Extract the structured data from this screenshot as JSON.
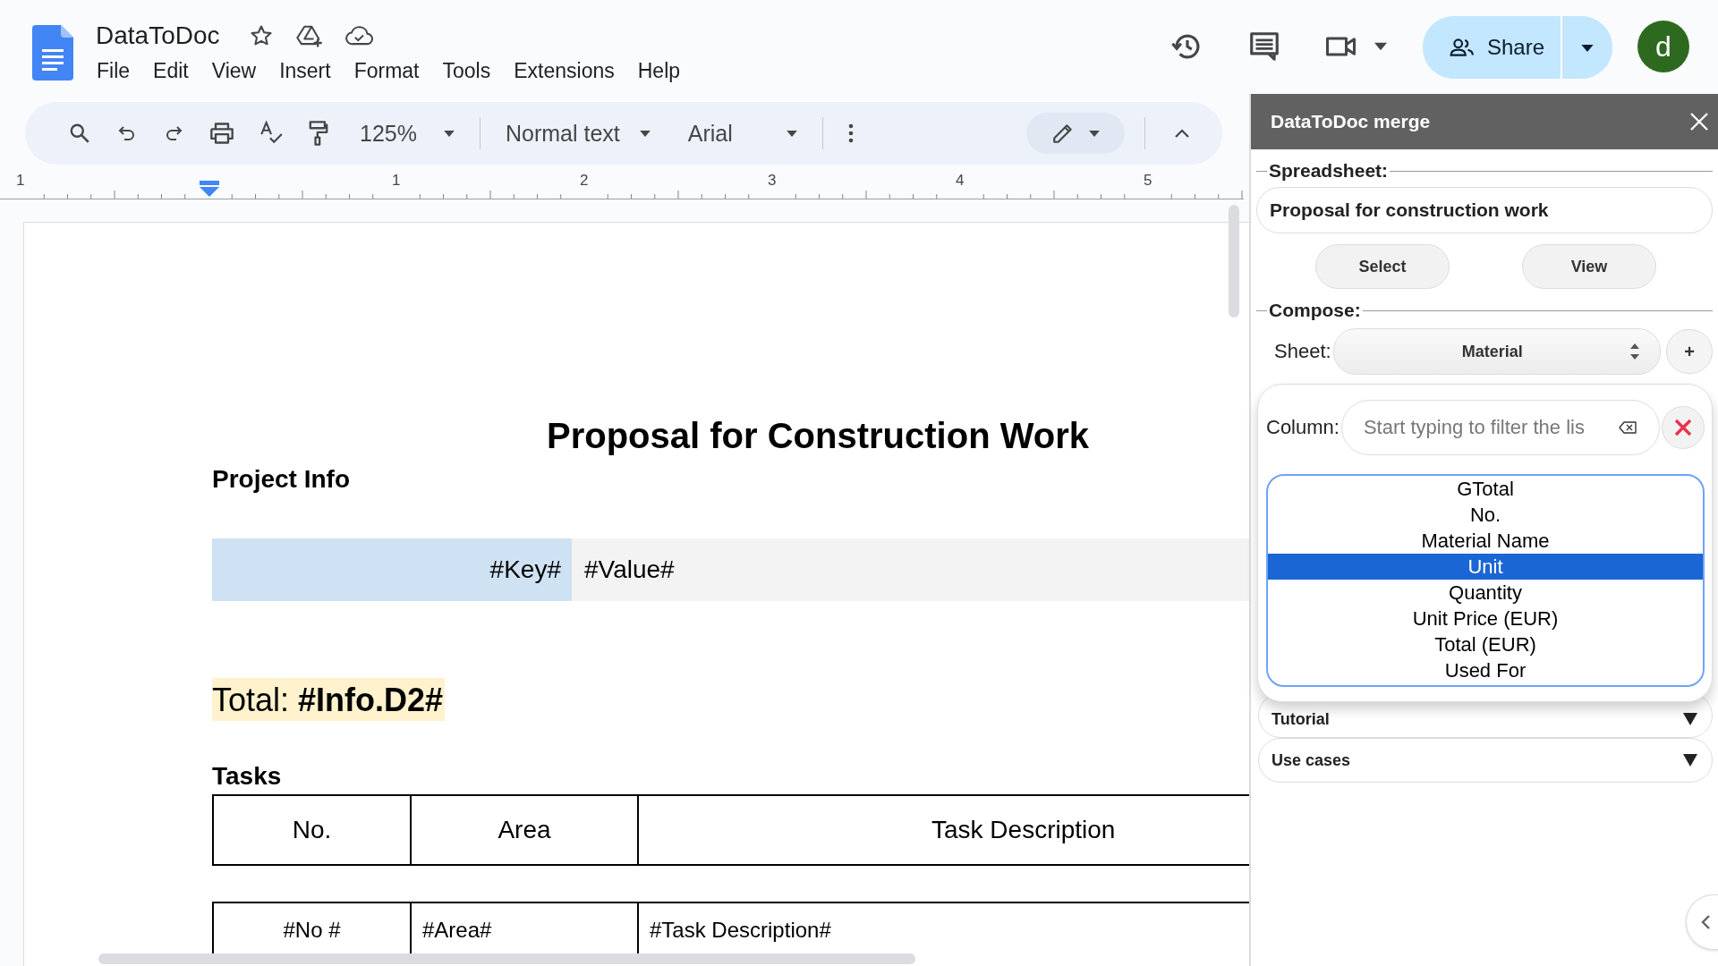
{
  "app": {
    "title": "DataToDoc",
    "menu": [
      "File",
      "Edit",
      "View",
      "Insert",
      "Format",
      "Tools",
      "Extensions",
      "Help"
    ]
  },
  "share_button": "Share",
  "avatar": "d",
  "toolbar": {
    "zoom": "125%",
    "style": "Normal text",
    "font": "Arial"
  },
  "ruler": {
    "labels": [
      "1",
      "1",
      "2",
      "3",
      "4",
      "5"
    ]
  },
  "document": {
    "title": "Proposal for Construction Work",
    "heading": "Project Info",
    "info_table": {
      "key": "#Key#",
      "value": "#Value#"
    },
    "total": "Total: **#Info.D2#**",
    "tasks_heading": "Tasks",
    "tasks_table": {
      "columns": [
        "No.",
        "Area",
        "Task Description"
      ],
      "rows": [
        [
          "#No #",
          "#Area#",
          "#Task Description#"
        ]
      ]
    }
  },
  "sidebar": {
    "title": "DataToDoc merge",
    "spreadsheet_label": "Spreadsheet:",
    "spreadsheet": "Proposal for construction work",
    "buttons": [
      "Select",
      "View"
    ],
    "compose_label": "Compose:",
    "sheet_label": "Sheet:",
    "sheet": "Material",
    "add_button": "+",
    "column_label": "Column:",
    "column_filter": {
      "placeholder": "Start typing to filter the lis"
    },
    "columns": [
      {
        "label": "GTotal",
        "selected": false
      },
      {
        "label": "No.",
        "selected": false
      },
      {
        "label": "Material Name",
        "selected": false
      },
      {
        "label": "Unit",
        "selected": true
      },
      {
        "label": "Quantity",
        "selected": false
      },
      {
        "label": "Unit Price (EUR)",
        "selected": false
      },
      {
        "label": "Total (EUR)",
        "selected": false
      },
      {
        "label": "Used For",
        "selected": false
      }
    ],
    "sections": [
      {
        "label": "Tutorial",
        "expanded": false
      },
      {
        "label": "Use cases",
        "expanded": false
      }
    ]
  }
}
